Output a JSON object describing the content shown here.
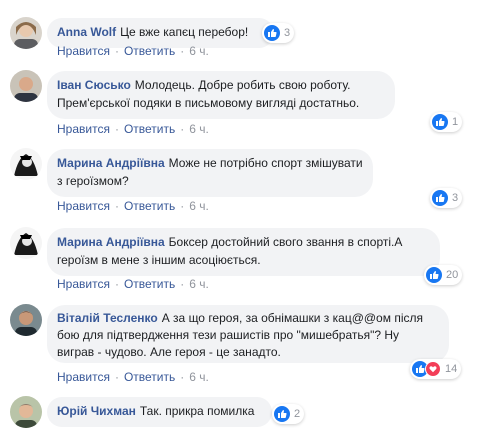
{
  "comments": [
    {
      "author": "Anna Wolf",
      "text": "Це вже капєц перебор!",
      "reaction_count": "3",
      "like_label": "Нравится",
      "reply_label": "Ответить",
      "time": "6 ч."
    },
    {
      "author": "Іван Сюсько",
      "text": "Молодець. Добре робить свою роботу. Прем'єрської подяки в письмовому вигляді достатньо.",
      "reaction_count": "1",
      "like_label": "Нравится",
      "reply_label": "Ответить",
      "time": "6 ч."
    },
    {
      "author": "Марина Андріївна",
      "text": "Може не потрібно спорт змішувати з героїзмом?",
      "reaction_count": "3",
      "like_label": "Нравится",
      "reply_label": "Ответить",
      "time": "6 ч."
    },
    {
      "author": "Марина Андріївна",
      "text": "Боксер достойний свого звання в спорті.А героїзм в мене з іншим асоціюється.",
      "reaction_count": "20",
      "like_label": "Нравится",
      "reply_label": "Ответить",
      "time": "6 ч."
    },
    {
      "author": "Віталій Тесленко",
      "text": "А за що героя, за обнімашки з кац@@ом після бою для підтвердження тези рашистів про \"мишебратья\"? Ну виграв - чудово. Але героя - це занадто.",
      "reaction_count": "14",
      "like_label": "Нравится",
      "reply_label": "Ответить",
      "time": "6 ч."
    },
    {
      "author": "Юрій Чихман",
      "text": "Так. прикра помилка",
      "reaction_count": "2"
    }
  ],
  "colors": {
    "author": "#385898",
    "bubble": "#f2f3f5",
    "meta": "#90949c",
    "like": "#1877f2",
    "love": "#f33e58"
  }
}
